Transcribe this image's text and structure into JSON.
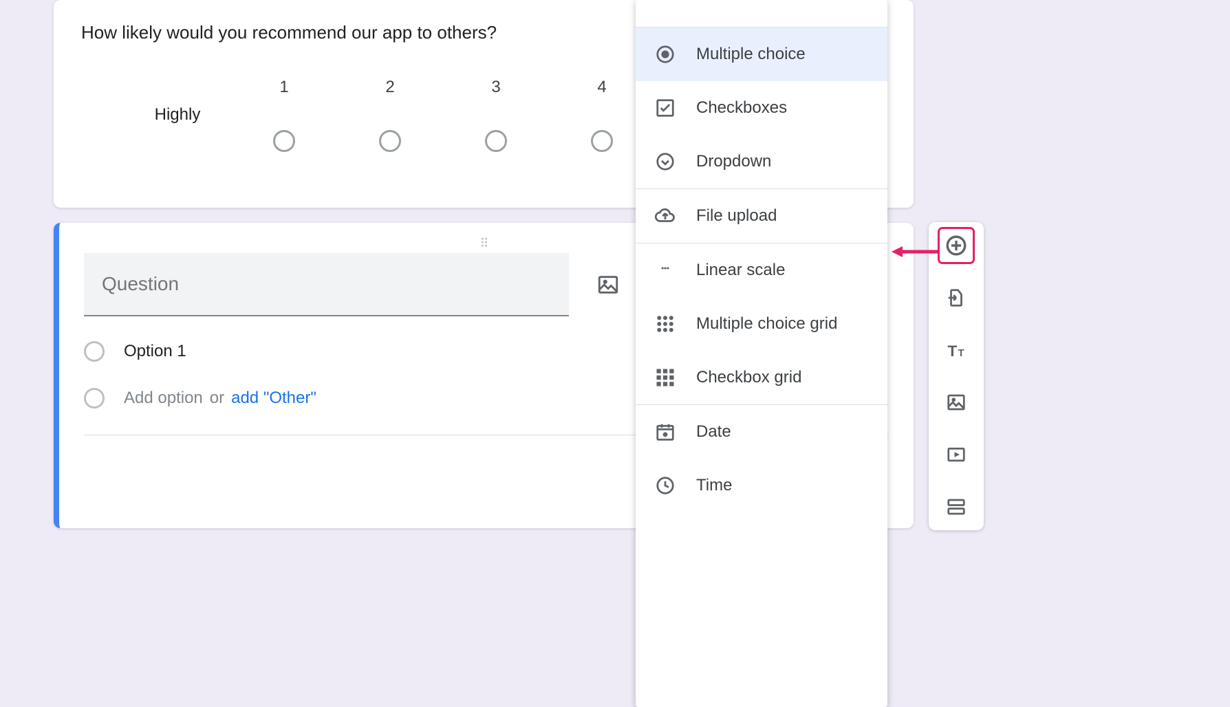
{
  "card1": {
    "question": "How likely would you recommend our app to others?",
    "low_label": "Highly",
    "scale": [
      "1",
      "2",
      "3",
      "4"
    ]
  },
  "card2": {
    "question_placeholder": "Question",
    "option1": "Option 1",
    "add_option": "Add option",
    "or": "or",
    "add_other": "add \"Other\""
  },
  "dropdown": {
    "multiple_choice": "Multiple choice",
    "checkboxes": "Checkboxes",
    "dropdown": "Dropdown",
    "file_upload": "File upload",
    "linear_scale": "Linear scale",
    "mc_grid": "Multiple choice grid",
    "checkbox_grid": "Checkbox grid",
    "date": "Date",
    "time": "Time"
  }
}
